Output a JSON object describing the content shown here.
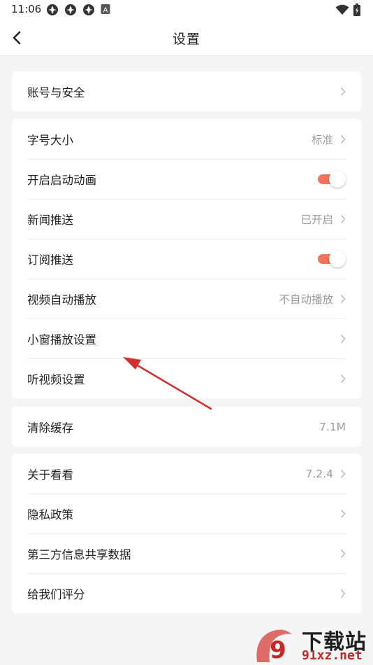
{
  "status_bar": {
    "time": "11:06",
    "icons": [
      "notification-icon",
      "notification-icon",
      "notification-icon",
      "a-icon"
    ],
    "a_icon_letter": "A",
    "right_icons": [
      "wifi-icon",
      "battery-icon"
    ]
  },
  "nav": {
    "title": "设置",
    "back_icon": "chevron-left-icon"
  },
  "groups": [
    {
      "rows": [
        {
          "label": "账号与安全",
          "value": "",
          "control": "chevron"
        }
      ]
    },
    {
      "rows": [
        {
          "label": "字号大小",
          "value": "标准",
          "control": "chevron"
        },
        {
          "label": "开启启动动画",
          "value": "",
          "control": "toggle",
          "on": true
        },
        {
          "label": "新闻推送",
          "value": "已开启",
          "control": "chevron"
        },
        {
          "label": "订阅推送",
          "value": "",
          "control": "toggle",
          "on": true
        },
        {
          "label": "视频自动播放",
          "value": "不自动播放",
          "control": "chevron"
        },
        {
          "label": "小窗播放设置",
          "value": "",
          "control": "chevron"
        },
        {
          "label": "听视频设置",
          "value": "",
          "control": "chevron"
        }
      ]
    },
    {
      "rows": [
        {
          "label": "清除缓存",
          "value": "7.1M",
          "control": "none"
        }
      ]
    },
    {
      "rows": [
        {
          "label": "关于看看",
          "value": "7.2.4",
          "control": "chevron"
        },
        {
          "label": "隐私政策",
          "value": "",
          "control": "chevron"
        },
        {
          "label": "第三方信息共享数据",
          "value": "",
          "control": "chevron"
        },
        {
          "label": "给我们评分",
          "value": "",
          "control": "chevron"
        }
      ]
    }
  ],
  "colors": {
    "toggle_on": "#f0735a",
    "annotation_arrow": "#d32f2f",
    "watermark_red": "#c62828"
  },
  "watermark": {
    "line1": "下载站",
    "line2": "91xz.net",
    "logo_text": "9"
  }
}
